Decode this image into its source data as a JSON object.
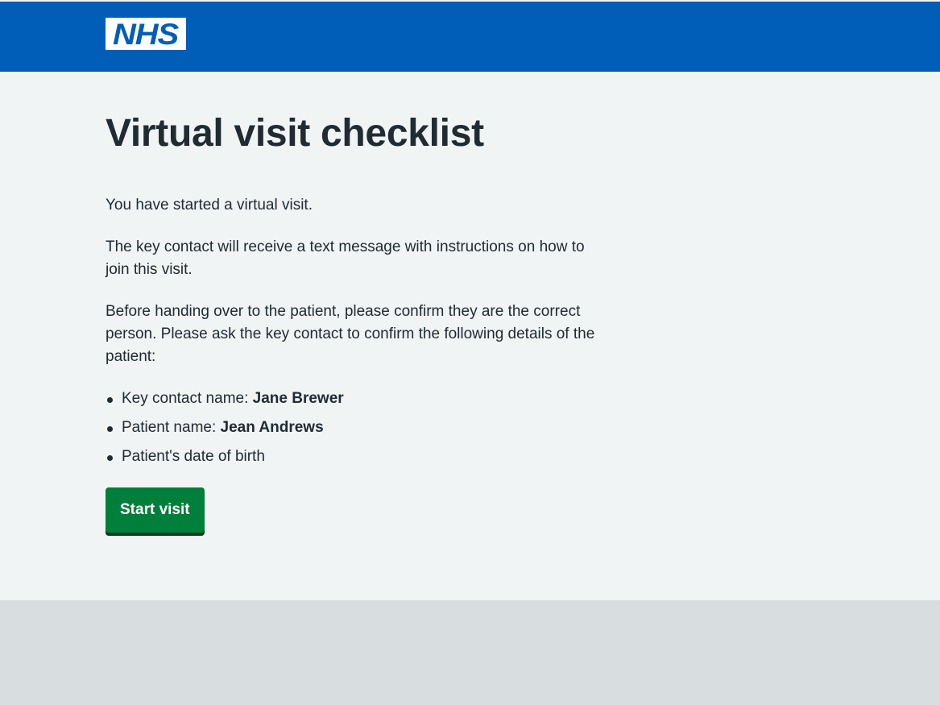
{
  "header": {
    "logo_text": "NHS"
  },
  "page": {
    "title": "Virtual visit checklist",
    "paragraphs": [
      "You have started a virtual visit.",
      "The key contact will receive a text message with instructions on how to join this visit.",
      "Before handing over to the patient, please confirm they are the correct person. Please ask the key contact to confirm the following details of the patient:"
    ],
    "details": [
      {
        "label": "Key contact name: ",
        "value": "Jane Brewer"
      },
      {
        "label": "Patient name: ",
        "value": "Jean Andrews"
      },
      {
        "label": "Patient's date of birth",
        "value": ""
      }
    ],
    "start_button_label": "Start visit"
  },
  "colors": {
    "header_blue": "#005eb8",
    "page_background": "#f0f4f5",
    "footer_grey": "#d8dde0",
    "button_green": "#007f3b",
    "text": "#212b32"
  }
}
